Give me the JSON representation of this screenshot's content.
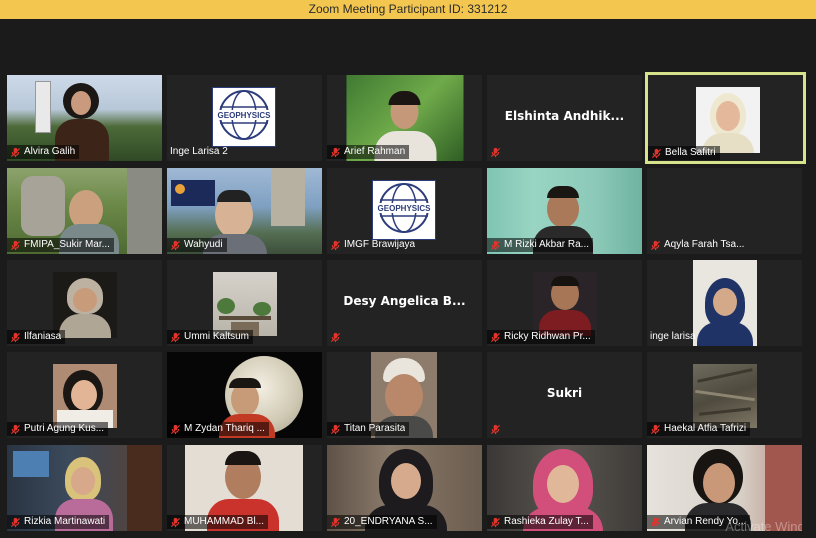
{
  "window": {
    "title": "Zoom Meeting Participant ID: 331212"
  },
  "participants": [
    {
      "name": "Alvira Galih"
    },
    {
      "name": "Inge Larisa 2"
    },
    {
      "name": "Arief Rahman"
    },
    {
      "name": "",
      "display_name": "Elshinta Andhik..."
    },
    {
      "name": "Bella Safitri",
      "active_speaker": true
    },
    {
      "name": "FMIPA_Sukir Mar..."
    },
    {
      "name": "Wahyudi"
    },
    {
      "name": "IMGF Brawijaya"
    },
    {
      "name": "M Rizki Akbar Ra..."
    },
    {
      "name": "Aqyla Farah Tsa..."
    },
    {
      "name": "Ilfaniasa"
    },
    {
      "name": "Ummi Kaltsum"
    },
    {
      "name": "",
      "display_name": "Desy Angelica B..."
    },
    {
      "name": "Ricky Ridhwan Pr..."
    },
    {
      "name": "inge larisa"
    },
    {
      "name": "Putri Agung Kus..."
    },
    {
      "name": "M Zydan Thariq ..."
    },
    {
      "name": "Titan Parasita"
    },
    {
      "name": "",
      "display_name": "Sukri"
    },
    {
      "name": "Haekal Atfia Tafrizi"
    },
    {
      "name": "Rizkia Martinawati"
    },
    {
      "name": "MUHAMMAD Bl..."
    },
    {
      "name": "20_ENDRYANA S..."
    },
    {
      "name": "Rashieka Zulay T..."
    },
    {
      "name": "Arvian Rendy Yo..."
    }
  ],
  "logo_text": "GEOPHYSICS",
  "watermark": "Activate Windo",
  "colors": {
    "title_bar": "#f3c74f",
    "active_speaker_border": "#d6e38a",
    "mute_icon": "#e0342c",
    "background": "#1b1b1b"
  }
}
